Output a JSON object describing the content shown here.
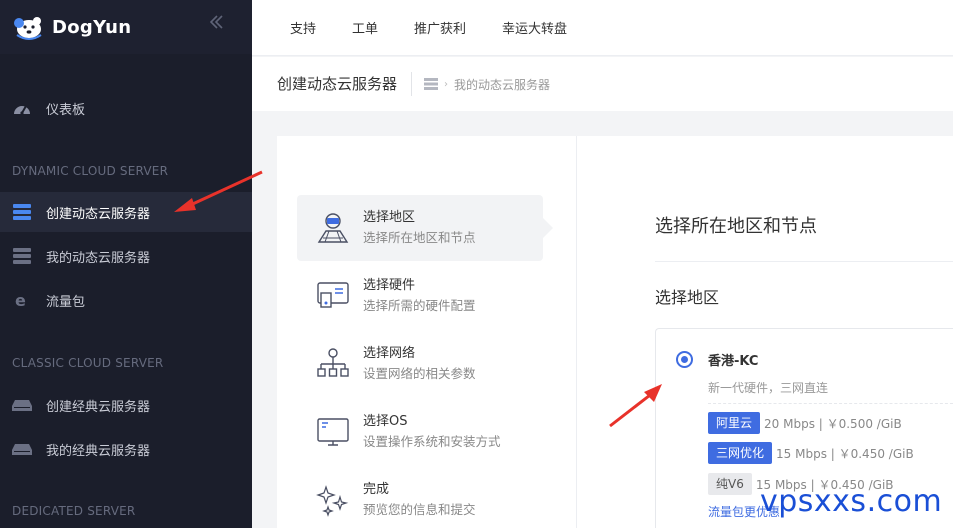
{
  "brand": {
    "name": "DogYun"
  },
  "sidebar": {
    "collapse_icon": "double-chevron-left-icon",
    "items": [
      {
        "label": "仪表板",
        "icon": "dashboard-icon"
      },
      {
        "label": "创建动态云服务器",
        "icon": "server-stack-icon"
      },
      {
        "label": "我的动态云服务器",
        "icon": "server-stack-icon"
      },
      {
        "label": "流量包",
        "icon": "ie-e-icon"
      },
      {
        "label": "创建经典云服务器",
        "icon": "drive-icon"
      },
      {
        "label": "我的经典云服务器",
        "icon": "drive-icon"
      }
    ],
    "sections": [
      "DYNAMIC CLOUD SERVER",
      "CLASSIC CLOUD SERVER",
      "DEDICATED SERVER"
    ]
  },
  "topnav": [
    "支持",
    "工单",
    "推广获利",
    "幸运大转盘"
  ],
  "breadcrumb": {
    "title": "创建动态云服务器",
    "path": "我的动态云服务器",
    "icon": "server-stack-icon"
  },
  "steps": [
    {
      "title": "选择地区",
      "sub": "选择所在地区和节点",
      "icon": "map-region-icon"
    },
    {
      "title": "选择硬件",
      "sub": "选择所需的硬件配置",
      "icon": "hardware-icon"
    },
    {
      "title": "选择网络",
      "sub": "设置网络的相关参数",
      "icon": "network-icon"
    },
    {
      "title": "选择OS",
      "sub": "设置操作系统和安装方式",
      "icon": "monitor-icon"
    },
    {
      "title": "完成",
      "sub": "预览您的信息和提交",
      "icon": "sparkle-icon"
    }
  ],
  "main": {
    "title": "选择所在地区和节点",
    "subtitle": "选择地区",
    "region": {
      "name": "香港-KC",
      "desc": "新一代硬件，三网直连",
      "tags": [
        {
          "label": "阿里云",
          "detail": "20 Mbps | ￥0.500 /GiB",
          "style": "blue"
        },
        {
          "label": "三网优化",
          "detail": "15 Mbps | ￥0.450 /GiB",
          "style": "blue"
        },
        {
          "label": "纯V6",
          "detail": "15 Mbps | ￥0.450 /GiB",
          "style": "grey"
        }
      ],
      "link": "流量包更优惠"
    }
  },
  "watermark": "vpsxxs.com",
  "colors": {
    "accent": "#3f6ce1",
    "sidebar_bg": "#1b1e2b",
    "annotation": "#e8322a"
  }
}
